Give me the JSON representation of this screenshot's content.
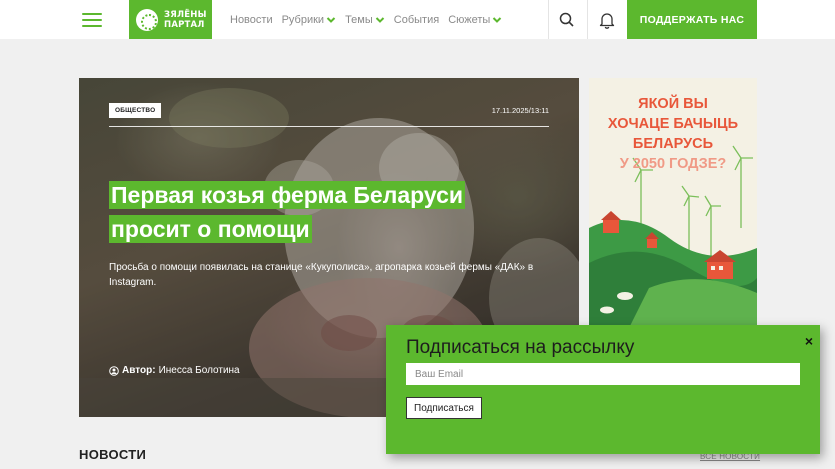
{
  "header": {
    "logo_line1": "ЗЯЛЁНЫ",
    "logo_line2": "ПАРТАЛ",
    "nav": [
      {
        "label": "Новости",
        "dropdown": false
      },
      {
        "label": "Рубрики",
        "dropdown": true
      },
      {
        "label": "Темы",
        "dropdown": true
      },
      {
        "label": "События",
        "dropdown": false
      },
      {
        "label": "Сюжеты",
        "dropdown": true
      }
    ],
    "support_label": "ПОДДЕРЖАТЬ НАС",
    "accent": "#5cb82e"
  },
  "hero": {
    "tag": "ОБЩЕСТВО",
    "date": "17.11.2025/13:11",
    "title_line1": "Первая козья ферма Беларуси",
    "title_line2": "просит о помощи",
    "lead": "Просьба о помощи появилась на станице «Кукуполиса», агропарка козьей фермы «ДАК» в Instagram.",
    "author_prefix": "Автор:",
    "author_name": "Инесса Болотина"
  },
  "banner": {
    "line1": "ЯКОЙ ВЫ",
    "line2": "ХОЧАЦЕ БАЧЫЦЬ",
    "line3": "БЕЛАРУСЬ",
    "line4": "У 2050 ГОДЗЕ?"
  },
  "news": {
    "title": "НОВОСТИ",
    "all_link": "ВСЕ НОВОСТИ"
  },
  "popup": {
    "title": "Подписаться на рассылку",
    "close": "×",
    "email_placeholder": "Ваш Email",
    "submit_label": "Подписаться"
  }
}
